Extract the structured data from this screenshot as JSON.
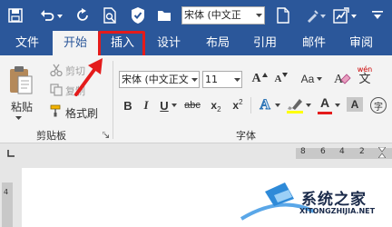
{
  "qat": {
    "font_value": "宋体 (中文正",
    "icons": [
      "save-icon",
      "undo-icon",
      "redo-icon",
      "print-preview-icon",
      "security-icon",
      "folder-icon",
      "new-doc-icon",
      "format-painter-icon",
      "macro-icon"
    ]
  },
  "tabs": [
    {
      "label": "文件"
    },
    {
      "label": "开始",
      "active": true
    },
    {
      "label": "插入",
      "highlighted": true
    },
    {
      "label": "设计"
    },
    {
      "label": "布局"
    },
    {
      "label": "引用"
    },
    {
      "label": "邮件"
    },
    {
      "label": "审阅"
    }
  ],
  "clipboard": {
    "paste_label": "粘贴",
    "cut_label": "剪切",
    "copy_label": "复制",
    "format_painter_label": "格式刷",
    "group_label": "剪贴板"
  },
  "font": {
    "font_value": "宋体 (中文正文",
    "size_value": "11",
    "group_label": "字体",
    "wen_label": "wén",
    "wen_char": "文",
    "enclosed_char": "字",
    "bold": "B",
    "italic": "I",
    "underline": "U",
    "strike": "abc",
    "subscript": "x",
    "sub_mark": "2",
    "superscript": "x",
    "sup_mark": "2",
    "highlight_glyph": "ab",
    "font_color_glyph": "A",
    "case_glyph": "Aa",
    "grow_glyph": "A",
    "shrink_glyph": "A",
    "text_effect_glyph": "A"
  },
  "ruler": {
    "marks": [
      "8",
      "6",
      "4",
      "2"
    ],
    "left_mark": "4"
  },
  "watermark": {
    "title": "系统之家",
    "url": "XITONGZHIJIA.NET"
  },
  "colors": {
    "accent": "#2b579a",
    "highlight_box": "#e41b1b",
    "arrow": "#e41b1b",
    "font_color_bar": "#e41b1b",
    "highlight_bar": "#ffff00"
  }
}
